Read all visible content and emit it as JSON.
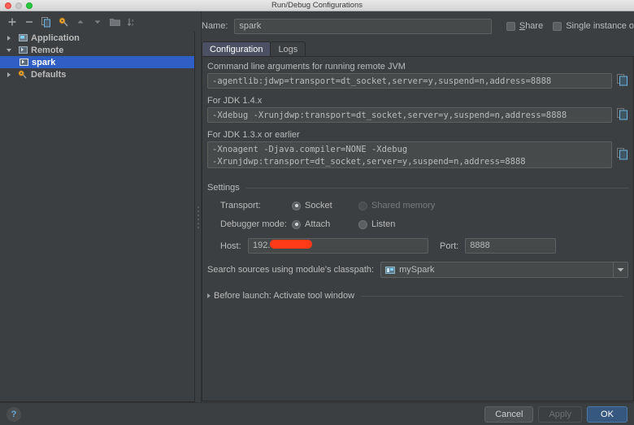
{
  "window": {
    "title": "Run/Debug Configurations"
  },
  "traffic_lights": [
    {
      "name": "close-button",
      "color": "#ff5f57"
    },
    {
      "name": "minimize-button",
      "color": "#c9c9c9"
    },
    {
      "name": "maximize-button",
      "color": "#28c840"
    }
  ],
  "sidebar": {
    "toolbar": [
      {
        "icon": "plus-icon",
        "label": "Add"
      },
      {
        "icon": "minus-icon",
        "label": "Remove"
      },
      {
        "icon": "copy-icon",
        "label": "Copy"
      },
      {
        "icon": "wrench-icon",
        "label": "Edit defaults"
      },
      {
        "icon": "arrow-up-icon",
        "label": "Move up"
      },
      {
        "icon": "arrow-down-icon",
        "label": "Move down"
      },
      {
        "icon": "folder-icon",
        "label": "Create folder"
      },
      {
        "icon": "sort-icon",
        "label": "Sort configurations"
      }
    ],
    "items": [
      {
        "label": "Application",
        "icon": "application-icon",
        "expanded": false,
        "selected": false,
        "indent": 0
      },
      {
        "label": "Remote",
        "icon": "remote-icon",
        "expanded": true,
        "selected": false,
        "indent": 0
      },
      {
        "label": "spark",
        "icon": "remote-icon",
        "expanded": null,
        "selected": true,
        "indent": 1
      },
      {
        "label": "Defaults",
        "icon": "wrench-icon",
        "expanded": false,
        "selected": false,
        "indent": 0
      }
    ]
  },
  "form": {
    "name_label": "Name:",
    "name_value": "spark",
    "share_label": "Share",
    "share_checked": false,
    "single_instance_label": "Single instance o",
    "single_instance_checked": false
  },
  "tabs": [
    {
      "label": "Configuration",
      "active": true
    },
    {
      "label": "Logs",
      "active": false
    }
  ],
  "config": {
    "cmdline_label": "Command line arguments for running remote JVM",
    "cmdline_value": "-agentlib:jdwp=transport=dt_socket,server=y,suspend=n,address=8888",
    "jdk14_label": "For JDK 1.4.x",
    "jdk14_value": "-Xdebug -Xrunjdwp:transport=dt_socket,server=y,suspend=n,address=8888",
    "jdk13_label": "For JDK 1.3.x or earlier",
    "jdk13_value_line1": "-Xnoagent -Djava.compiler=NONE -Xdebug",
    "jdk13_value_line2": "-Xrunjdwp:transport=dt_socket,server=y,suspend=n,address=8888",
    "copy_icon": "copy-to-clipboard-icon",
    "settings_label": "Settings",
    "transport_label": "Transport:",
    "transport_options": [
      {
        "label": "Socket",
        "selected": true,
        "disabled": false
      },
      {
        "label": "Shared memory",
        "selected": false,
        "disabled": true
      }
    ],
    "debugger_mode_label": "Debugger mode:",
    "debugger_mode_options": [
      {
        "label": "Attach",
        "selected": true,
        "disabled": false
      },
      {
        "label": "Listen",
        "selected": false,
        "disabled": false
      }
    ],
    "host_label": "Host:",
    "host_value": "192.",
    "host_redacted": true,
    "port_label": "Port:",
    "port_value": "8888",
    "classpath_label": "Search sources using module's classpath:",
    "classpath_value": "mySpark",
    "classpath_icon": "module-icon",
    "before_launch_label": "Before launch: Activate tool window",
    "before_launch_expanded": false
  },
  "footer": {
    "help_label": "?",
    "buttons": [
      {
        "label": "Cancel",
        "style": "normal"
      },
      {
        "label": "Apply",
        "style": "disabled"
      },
      {
        "label": "OK",
        "style": "default"
      }
    ]
  },
  "colors": {
    "background": "#3c3f41",
    "selection": "#2f5ec4",
    "accent": "#365880",
    "redaction": "#ff3b18",
    "text": "#bbbbbb"
  }
}
